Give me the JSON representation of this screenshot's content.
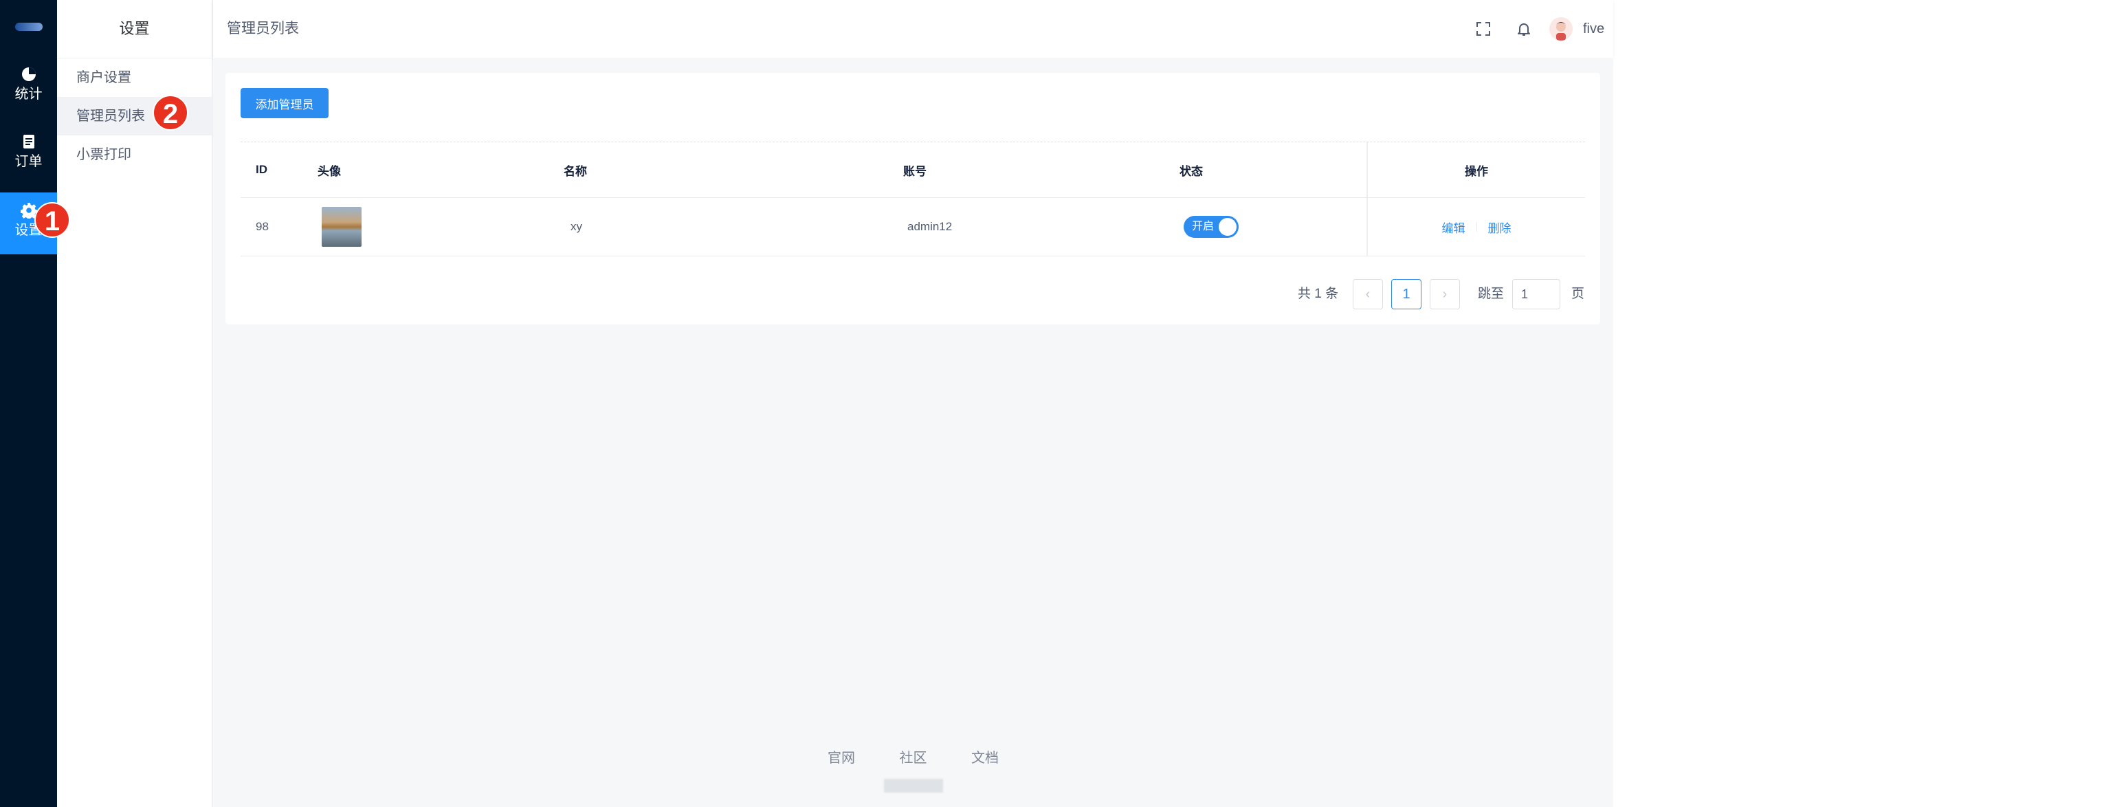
{
  "rail": {
    "items": [
      {
        "label": "统计",
        "icon": "pie-chart-icon"
      },
      {
        "label": "订单",
        "icon": "document-icon"
      },
      {
        "label": "设置",
        "icon": "gear-icon"
      }
    ]
  },
  "submenu": {
    "title": "设置",
    "items": [
      {
        "label": "商户设置"
      },
      {
        "label": "管理员列表"
      },
      {
        "label": "小票打印"
      }
    ]
  },
  "header": {
    "breadcrumb": "管理员列表",
    "user_name": "five",
    "icons": [
      "fullscreen-icon",
      "bell-icon",
      "user-avatar"
    ]
  },
  "toolbar": {
    "add_button": "添加管理员"
  },
  "table": {
    "columns": [
      "ID",
      "头像",
      "名称",
      "账号",
      "状态",
      "操作"
    ],
    "rows": [
      {
        "id": "98",
        "name": "xy",
        "account": "admin12",
        "status": "开启",
        "actions": [
          "编辑",
          "删除"
        ]
      }
    ]
  },
  "pager": {
    "total_text": "共 1 条",
    "current_page": "1",
    "goto_label": "跳至",
    "goto_value": "1",
    "page_suffix": "页"
  },
  "footer": {
    "links": [
      "官网",
      "社区",
      "文档"
    ]
  },
  "annotations": {
    "markers": [
      "1",
      "2"
    ]
  },
  "colors": {
    "primary": "#2d8cf0",
    "rail_bg": "#001529",
    "marker": "#e8321f"
  }
}
